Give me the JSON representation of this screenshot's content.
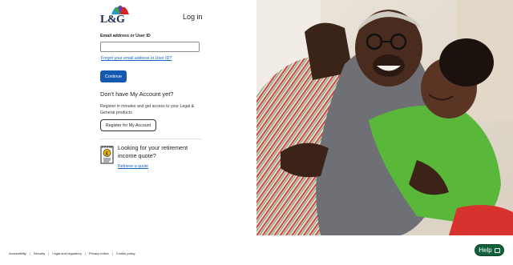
{
  "brand": {
    "logo_text": "L&G"
  },
  "login": {
    "title": "Log in",
    "email_label": "Email address or User ID",
    "email_value": "",
    "forgot_link": "Forgot your email address or User ID?",
    "continue_button": "Continue"
  },
  "register": {
    "heading": "Don't have My Account yet?",
    "description": "Register in minutes and get access to your Legal & General products",
    "button": "Register for My Account"
  },
  "retirement": {
    "question": "Looking for your retirement income quote?",
    "link": "Retrieve a quote"
  },
  "footer": {
    "links": [
      "Accessibility",
      "Security",
      "Legal and regulatory",
      "Privacy notice",
      "Cookie policy"
    ],
    "separator": "|"
  },
  "help": {
    "label": "Help"
  },
  "colors": {
    "primary": "#1558b0",
    "help_green": "#12603a",
    "link": "#1565c0"
  }
}
